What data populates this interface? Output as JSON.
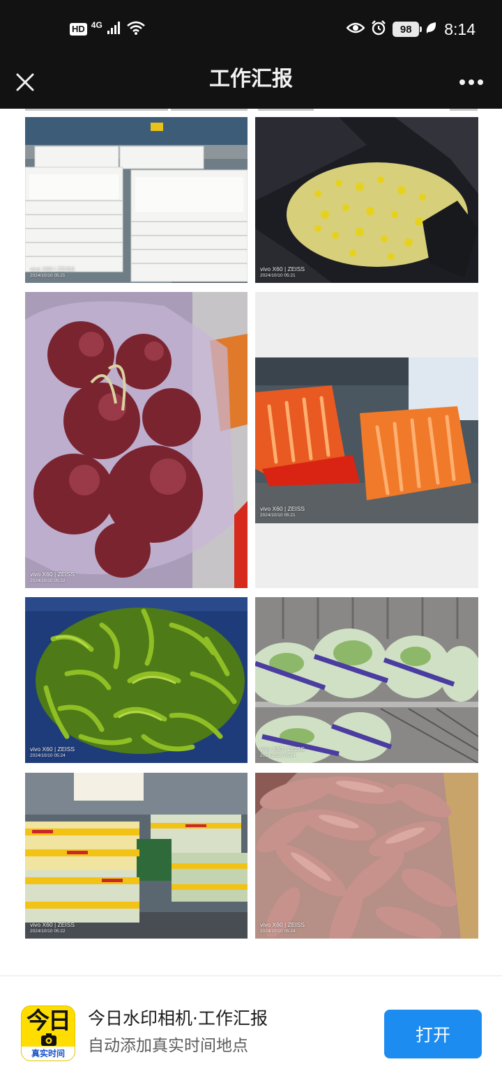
{
  "status_bar": {
    "hd_badge": "HD",
    "network": "4G",
    "battery": "98",
    "time": "8:14",
    "icons": [
      "signal-icon",
      "wifi-icon",
      "eye-icon",
      "alarm-icon",
      "battery-icon",
      "leaf-icon"
    ]
  },
  "header": {
    "title": "工作汇报",
    "close_icon": "close-icon",
    "more_icon": "more-icon"
  },
  "photos": [
    {
      "subject": "stacked white plastic trays",
      "wm_brand": "vivo X60 | ZEISS",
      "wm_date": "2024/10/10 05:21"
    },
    {
      "subject": "bean sprouts in black bag",
      "wm_brand": "vivo X60 | ZEISS",
      "wm_date": "2024/10/10 05:21"
    },
    {
      "subject": "red onions in bag",
      "wm_brand": "vivo X60 | ZEISS",
      "wm_date": "2024/10/10 05:22"
    },
    {
      "subject": "bagged carrots",
      "wm_brand": "vivo X60 | ZEISS",
      "wm_date": "2024/10/10 05:21"
    },
    {
      "subject": "green chili peppers",
      "wm_brand": "vivo X60 | ZEISS",
      "wm_date": "2024/10/10 05:24"
    },
    {
      "subject": "packaged vegetables on rack",
      "wm_brand": "vivo X60 | ZEISS",
      "wm_date": "2024/10/10 05:24"
    },
    {
      "subject": "wrapped vegetable bundles",
      "wm_brand": "vivo X60 | ZEISS",
      "wm_date": "2024/10/10 05:22"
    },
    {
      "subject": "sweet potatoes in box",
      "wm_brand": "vivo X60 | ZEISS",
      "wm_date": "2024/10/10 05:24"
    }
  ],
  "banner": {
    "app_icon_top": "今日",
    "app_icon_bottom": "真实时间",
    "app_name": "今日水印相机·工作汇报",
    "app_desc": "自动添加真实时间地点",
    "open_label": "打开"
  },
  "colors": {
    "header_bg": "#121212",
    "open_button": "#1d8cf0",
    "app_icon_yellow": "#ffdd00"
  }
}
